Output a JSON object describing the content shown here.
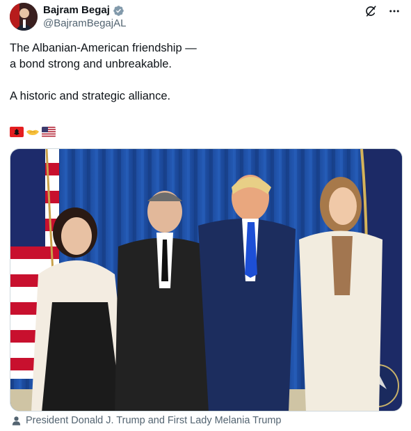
{
  "author": {
    "display_name": "Bajram Begaj",
    "handle": "@BajramBegajAL",
    "verified_icon": "verified-badge-icon"
  },
  "actions": {
    "grok_icon": "grok-icon",
    "more_icon": "more-options-icon"
  },
  "tweet": {
    "line1": "The Albanian-American friendship —",
    "line2": "a bond strong and unbreakable.",
    "line3": "A historic and strategic alliance."
  },
  "emojis": [
    "albania-flag-emoji",
    "handshake-emoji",
    "us-flag-emoji"
  ],
  "media": {
    "tagged_people": "President Donald J. Trump and First Lady Melania Trump"
  },
  "colors": {
    "text": "#0f1419",
    "secondary": "#536471",
    "verified": "#829aab",
    "curtain": "#1f4fa0"
  }
}
